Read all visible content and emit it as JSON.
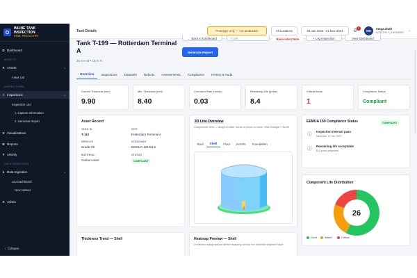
{
  "app": {
    "name_line1": "INLINE TANK",
    "name_line2": "INSPECTION",
    "tagline": "HTML PROTOTYPE"
  },
  "sidebar": {
    "dashboard": {
      "icon": "D",
      "label": "Dashboard"
    },
    "sections": {
      "assets": "ASSETS",
      "inspections": "INSPECTIONS",
      "data_ingestion": "DATA INGESTION"
    },
    "assets": {
      "icon": "A",
      "label": "Assets",
      "chevron": "⌄"
    },
    "asset_list": "Asset List",
    "inspections": {
      "icon": "I",
      "label": "Inspections",
      "chevron": "⌄"
    },
    "inspection_list": "Inspection List",
    "step1": "1. Capture Information",
    "step2": "2. Generate Report",
    "visualizations": {
      "icon": "V",
      "label": "Visualizations"
    },
    "reports": {
      "icon": "R",
      "label": "Reports"
    },
    "activity": {
      "icon": "Y",
      "label": "Activity"
    },
    "data_ingestion": {
      "icon": "J",
      "label": "Data Ingestion",
      "chevron": "⌄"
    },
    "job_dashboard": "Job Dashboard",
    "new_upload": "New Upload",
    "admin": {
      "icon": "A",
      "label": "Admin"
    },
    "collapse": "Collapse",
    "collapse_icon": "‹"
  },
  "topbar": {
    "breadcrumb": "Tank Details",
    "prototype_notice": "Prototype only — not production",
    "location": "All Locations",
    "date_range": "01 Jan 2024 - 31 Dec 2024",
    "notification_count": "2",
    "avatar_initials": "MS",
    "user_name": "maya.shah",
    "user_role": "INTEGRITY_ENGINEER",
    "menu_chevron": "⌄"
  },
  "header": {
    "title": "Tank T-199 — Rotterdam Terminal A",
    "subtitle": "20.5 m Ø • 15 m H",
    "back_button": "← Back to Dashboard",
    "select_value": "T-199",
    "alert_button": "Raise Alert Note",
    "log_button": "+ Log Inspection",
    "view_button": "View Dashboard",
    "generate_report": "Generate Report"
  },
  "tabs": [
    "Overview",
    "Inspections",
    "Datasets",
    "Defects",
    "Assessments",
    "Compliance",
    "History & Audit"
  ],
  "kpis": [
    {
      "label": "Current Thickness (mm)",
      "value": "9.90"
    },
    {
      "label": "Min. Thickness (mm)",
      "value": "8.40"
    },
    {
      "label": "Corrosion Rate (mm/yr)",
      "value": "0.03"
    },
    {
      "label": "Remaining Life (years)",
      "value": "8.4"
    },
    {
      "label": "Critical Areas",
      "value": "1"
    },
    {
      "label": "Compliance Status",
      "value": "Compliant"
    }
  ],
  "asset_record": {
    "title": "Asset Record",
    "tank_id_label": "TANK ID",
    "tank_id": "T-110",
    "site_label": "SITE",
    "site": "Rotterdam Terminal A",
    "service_label": "SERVICE",
    "service": "Crude Oil",
    "standard_label": "STANDARD",
    "standard": "EEMUA 159 Ed.6",
    "material_label": "MATERIAL",
    "material": "Carbon steel",
    "status_label": "STATUS",
    "status": "COMPLIANT"
  },
  "live_view": {
    "title": "3D Live Overview",
    "description": "Component view — drag to rotate, scroll or pinch to zoom. Blue triangle = North.",
    "tabs": [
      "Roof",
      "Shell",
      "Floor",
      "Nozzle",
      "Foundation"
    ]
  },
  "eemua": {
    "title": "EEMUA 159 Compliance Status",
    "badge": "COMPLIANT",
    "items": [
      {
        "n": "1",
        "title": "Inspection interval pass",
        "sub": "Next due 12 Jan 2027"
      },
      {
        "n": "2",
        "title": "Remaining life acceptable",
        "sub": "8.4 years projected"
      }
    ]
  },
  "life_distribution": {
    "title": "Component Life Distribution",
    "total": "26",
    "legend": [
      {
        "name": "Good",
        "color": "#22c55e"
      },
      {
        "name": "Watch",
        "color": "#f59e0b"
      },
      {
        "name": "Critical",
        "color": "#ef4444"
      }
    ]
  },
  "chart_data": {
    "type": "pie",
    "categories": [
      "Good",
      "Watch",
      "Critical"
    ],
    "values": [
      15,
      6,
      5
    ],
    "center_label": "26"
  },
  "thickness_trend": {
    "title": "Thickness Trend — Shell"
  },
  "heatmap": {
    "title": "Heatmap Preview — Shell",
    "description": "Localized topographical defect mapping across the selected segment layer."
  }
}
